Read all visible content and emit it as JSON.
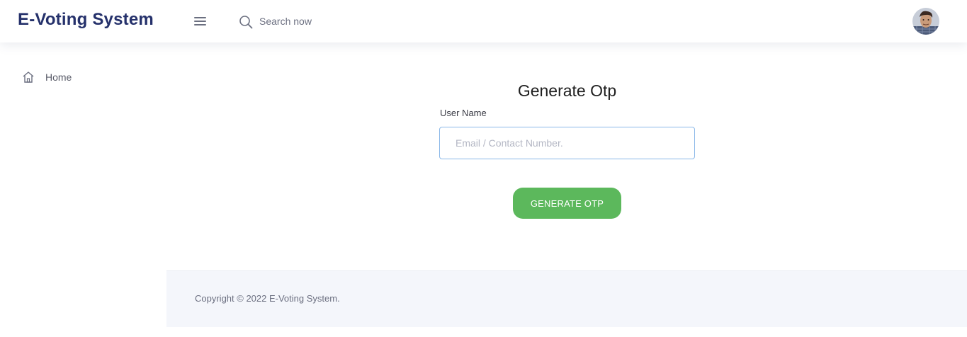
{
  "header": {
    "brand": "E-Voting System",
    "menu_icon": "hamburger-icon",
    "search": {
      "icon": "search-icon",
      "placeholder": "Search now",
      "value": ""
    },
    "avatar_icon": "user-avatar"
  },
  "sidebar": {
    "items": [
      {
        "label": "Home",
        "icon": "home-icon"
      }
    ]
  },
  "form": {
    "title": "Generate Otp",
    "username_label": "User Name",
    "username_placeholder": "Email / Contact Number.",
    "username_value": "",
    "submit_label": "GENERATE OTP"
  },
  "footer": {
    "copyright": "Copyright © 2022 E-Voting System."
  },
  "colors": {
    "brand": "#25316b",
    "button": "#5cb85c",
    "input_border": "#8bb8e8",
    "footer_bg": "#f4f6fb"
  }
}
